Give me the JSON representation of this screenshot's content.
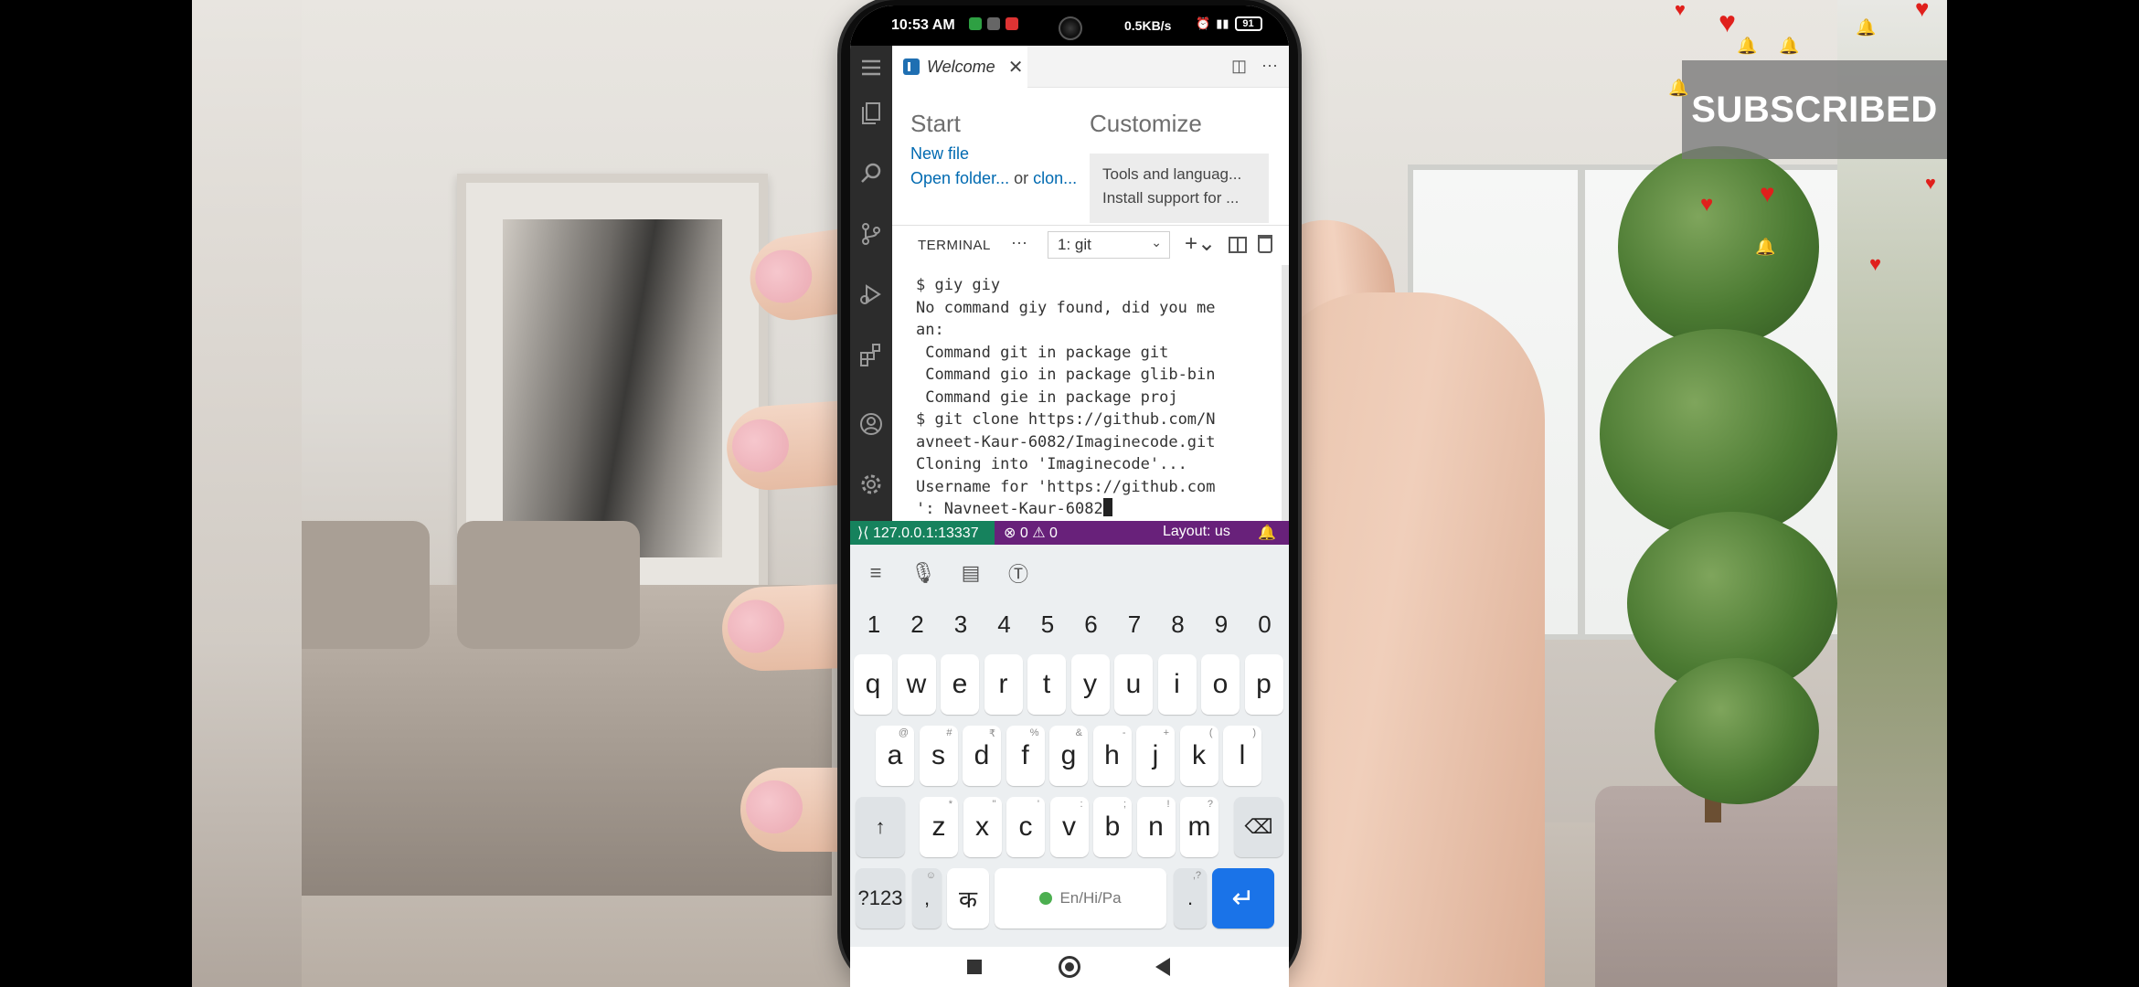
{
  "statusbar": {
    "time": "10:53 AM",
    "speed": "0.5KB/s",
    "battery": "91"
  },
  "overlay": {
    "subscribed_label": "SUBSCRIBED"
  },
  "editor": {
    "tab_label": "Welcome",
    "tab_close": "✕",
    "more_actions": "⋯"
  },
  "welcome": {
    "start_heading": "Start",
    "customize_heading": "Customize",
    "new_file": "New file",
    "open_folder": "Open folder...",
    "or": " or ",
    "clone": "clon...",
    "card_title": "Tools and languag...",
    "card_subtitle": "Install support for ..."
  },
  "panel": {
    "title": "TERMINAL",
    "more": "···",
    "terminal_select": "1: git",
    "plus_label": "+⌄"
  },
  "terminal": {
    "lines": [
      "$ giy giy",
      "No command giy found, did you me",
      "an:",
      " Command git in package git",
      " Command gio in package glib-bin",
      " Command gie in package proj",
      "$ git clone https://github.com/N",
      "avneet-Kaur-6082/Imaginecode.git",
      "Cloning into 'Imaginecode'...",
      "Username for 'https://github.com",
      "': Navneet-Kaur-6082"
    ]
  },
  "vs_status": {
    "remote": "127.0.0.1:13337",
    "errors": "⊗ 0 ⚠ 0",
    "layout": "Layout: us",
    "bell": "🔔"
  },
  "keyboard": {
    "numbers": [
      "1",
      "2",
      "3",
      "4",
      "5",
      "6",
      "7",
      "8",
      "9",
      "0"
    ],
    "row1": [
      "q",
      "w",
      "e",
      "r",
      "t",
      "y",
      "u",
      "i",
      "o",
      "p"
    ],
    "row2": [
      "a",
      "s",
      "d",
      "f",
      "g",
      "h",
      "j",
      "k",
      "l"
    ],
    "row2_hints": [
      "@",
      "#",
      "₹",
      "%",
      "&",
      "-",
      "+",
      "(",
      ")"
    ],
    "row3": [
      "z",
      "x",
      "c",
      "v",
      "b",
      "n",
      "m"
    ],
    "row3_hints": [
      "*",
      "\"",
      "'",
      ":",
      ";",
      "!",
      "?"
    ],
    "symbols_key": "?123",
    "comma_key": ",",
    "language_key": "क",
    "space_label": "En/Hi/Pa",
    "period_key": ".",
    "enter_key": "↵",
    "shift_key": "↑",
    "backspace_key": "⌫"
  },
  "colors": {
    "status_purple": "#68217a",
    "remote_green": "#16825d",
    "link_blue": "#006ab1",
    "enter_blue": "#1a73e8"
  }
}
